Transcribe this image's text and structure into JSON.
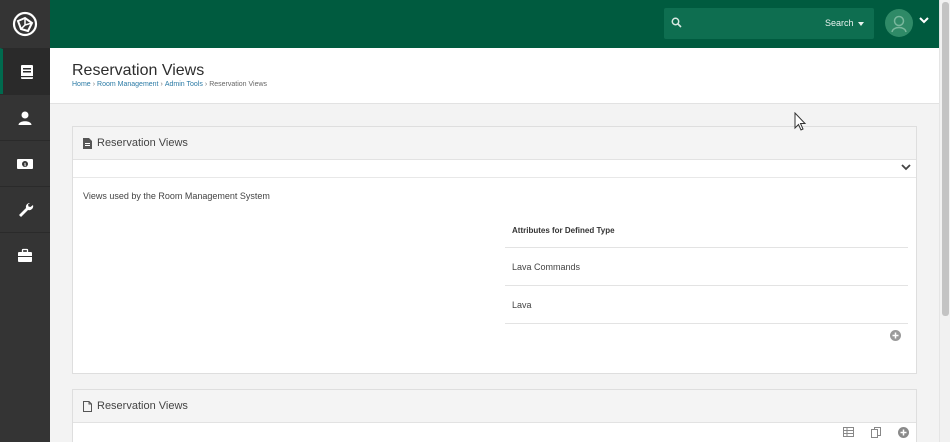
{
  "nav": {
    "items": [
      {
        "name": "book-icon"
      },
      {
        "name": "person-icon"
      },
      {
        "name": "money-icon"
      },
      {
        "name": "wrench-icon"
      },
      {
        "name": "briefcase-icon"
      }
    ]
  },
  "header": {
    "search_label": "Search",
    "page_title": "Reservation Views",
    "breadcrumb": {
      "home": "Home",
      "room_management": "Room Management",
      "admin_tools": "Admin Tools",
      "current": "Reservation Views"
    }
  },
  "panel1": {
    "title": "Reservation Views",
    "description": "Views used by the Room Management System",
    "attributes_header": "Attributes for Defined Type",
    "attributes": [
      "Lava Commands",
      "Lava"
    ]
  },
  "panel2": {
    "title": "Reservation Views"
  },
  "colors": {
    "brand": "#005b3f",
    "sidebar": "#343434",
    "link": "#2a7aa5"
  }
}
